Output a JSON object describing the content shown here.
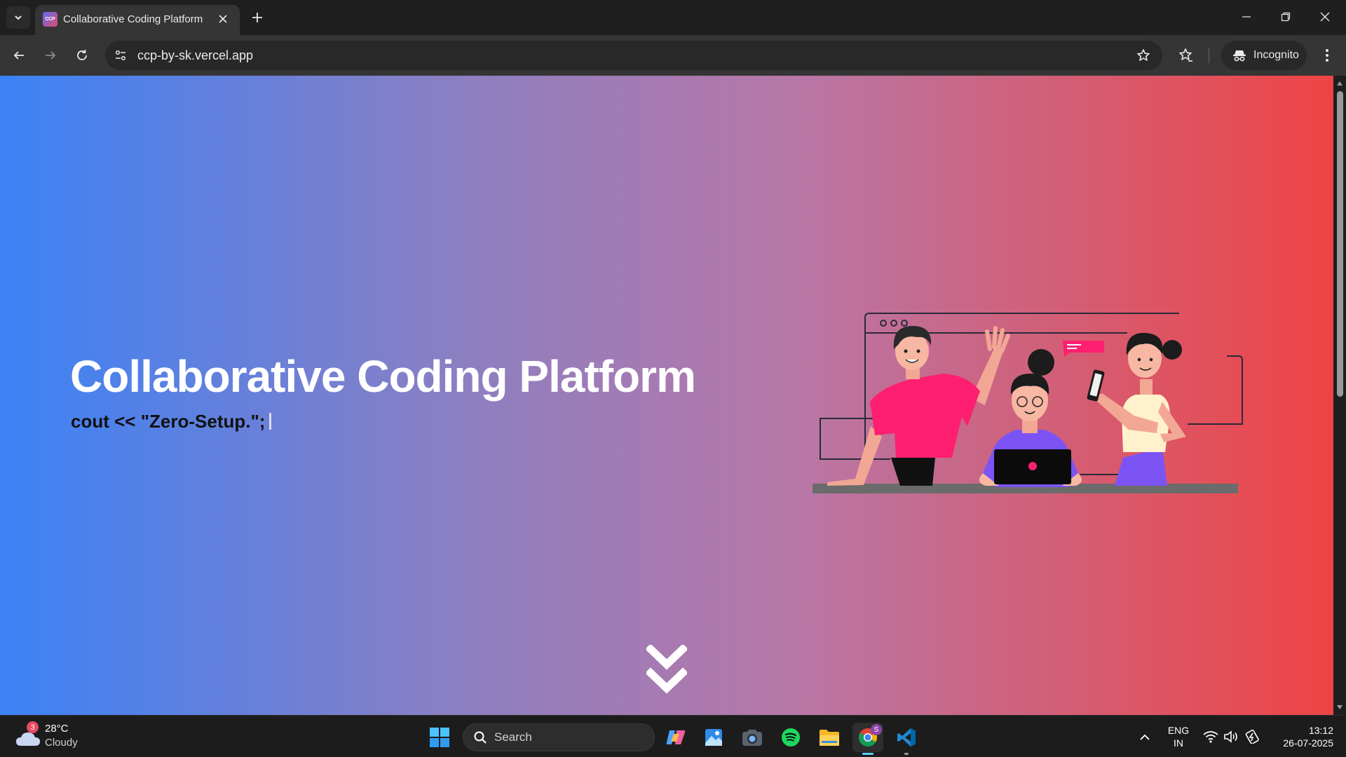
{
  "browser": {
    "tab_title": "Collaborative Coding Platform",
    "favicon_text": "CCP",
    "url": "ccp-by-sk.vercel.app",
    "incognito_label": "Incognito"
  },
  "page": {
    "hero_title": "Collaborative Coding Platform",
    "hero_code": "cout << \"Zero-Setup.\";",
    "gradient_colors": [
      "#3b82f6",
      "#8d7fc1",
      "#b877a6",
      "#ef4444"
    ]
  },
  "taskbar": {
    "weather_temp": "28°C",
    "weather_condition": "Cloudy",
    "weather_badge": "3",
    "search_label": "Search",
    "chrome_badge": "S",
    "lang_line1": "ENG",
    "lang_line2": "IN",
    "time": "13:12",
    "date": "26-07-2025"
  }
}
